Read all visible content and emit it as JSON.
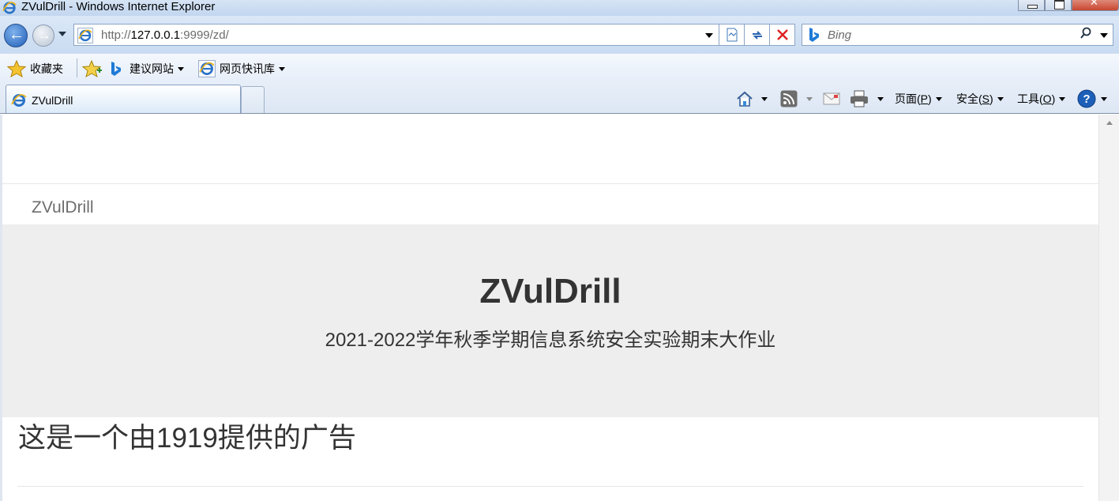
{
  "window": {
    "title": "ZVulDrill - Windows Internet Explorer"
  },
  "address_bar": {
    "url_prefix": "http://",
    "url_host": "127.0.0.1",
    "url_rest": ":9999/zd/"
  },
  "search": {
    "placeholder": "Bing"
  },
  "favorites_bar": {
    "favorites_label": "收藏夹",
    "suggested_sites_label": "建议网站",
    "web_slice_label": "网页快讯库"
  },
  "tabs": [
    {
      "label": "ZVulDrill"
    }
  ],
  "command_bar": {
    "page_label": "页面(",
    "page_key": "P",
    "page_close": ")",
    "safety_label": "安全(",
    "safety_key": "S",
    "safety_close": ")",
    "tools_label": "工具(",
    "tools_key": "O",
    "tools_close": ")"
  },
  "page": {
    "brand": "ZVulDrill",
    "hero_title": "ZVulDrill",
    "hero_subtitle": "2021-2022学年秋季学期信息系统安全实验期末大作业",
    "ad_text": "这是一个由1919提供的广告"
  },
  "icons": {
    "app": "ie-icon",
    "back": "back-arrow-icon",
    "forward": "forward-arrow-icon",
    "compat": "compatibility-view-icon",
    "refresh": "refresh-icon",
    "stop": "stop-icon",
    "search": "search-icon",
    "home": "home-icon",
    "feeds": "rss-icon",
    "mail": "mail-icon",
    "print": "printer-icon",
    "help": "help-icon"
  }
}
